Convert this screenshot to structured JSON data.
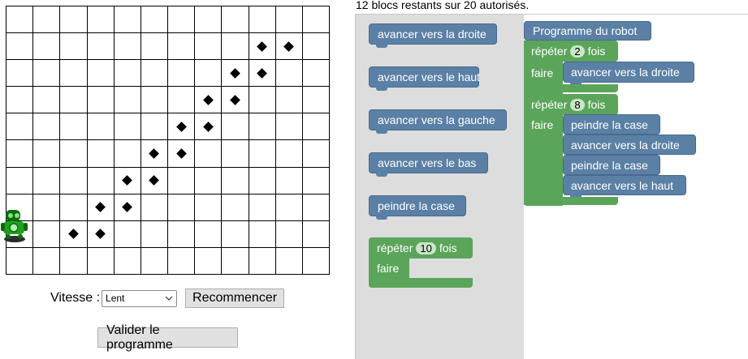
{
  "header": {
    "blocks_remaining": "12 blocs restants sur 20 autorisés."
  },
  "grid": {
    "cols": 12,
    "rows": 10,
    "marked_cells": [
      [
        1,
        9
      ],
      [
        1,
        10
      ],
      [
        2,
        8
      ],
      [
        2,
        9
      ],
      [
        3,
        7
      ],
      [
        3,
        8
      ],
      [
        4,
        6
      ],
      [
        4,
        7
      ],
      [
        5,
        5
      ],
      [
        5,
        6
      ],
      [
        6,
        4
      ],
      [
        6,
        5
      ],
      [
        7,
        3
      ],
      [
        7,
        4
      ],
      [
        8,
        2
      ],
      [
        8,
        3
      ]
    ],
    "robot_cell": [
      8,
      0
    ]
  },
  "controls": {
    "speed_label": "Vitesse :",
    "speed_value": "Lent",
    "restart_label": "Recommencer",
    "validate_label": "Valider le programme"
  },
  "toolbox": {
    "move_right": "avancer vers la droite",
    "move_up": "avancer vers le haut",
    "move_left": "avancer vers la gauche",
    "move_down": "avancer vers le bas",
    "paint": "peindre la case",
    "repeat_label": "répéter",
    "repeat_count": "10",
    "repeat_times": "fois",
    "do_label": "faire"
  },
  "program": {
    "title": "Programme du robot",
    "loop1": {
      "repeat_label": "répéter",
      "count": "2",
      "times": "fois",
      "do_label": "faire",
      "body": [
        "avancer vers la droite"
      ]
    },
    "loop2": {
      "repeat_label": "répéter",
      "count": "8",
      "times": "fois",
      "do_label": "faire",
      "body": [
        "peindre la case",
        "avancer vers la droite",
        "peindre la case",
        "avancer vers le haut"
      ]
    }
  },
  "colors": {
    "motion_block": "#5b80a5",
    "loop_block": "#5ba55b",
    "toolbox_bg": "#dddddd"
  }
}
